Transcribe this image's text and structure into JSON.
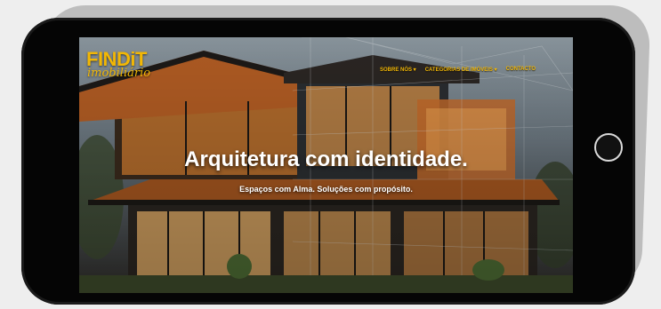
{
  "logo": {
    "brand": "FINDiT",
    "sub": "imobiliário"
  },
  "nav": {
    "items": [
      {
        "label": "SOBRE NÓS ▾"
      },
      {
        "label": "CATEGORIAS DE IMÓVEIS ▾"
      },
      {
        "label": "CONTACTO"
      }
    ]
  },
  "hero": {
    "title": "Arquitetura com identidade.",
    "subtitle": "Espaços com Alma. Soluções com propósito."
  },
  "colors": {
    "accent": "#f2b705",
    "device_frame": "#050505",
    "background": "#eeeeee"
  },
  "icons": [
    "home-button-icon"
  ]
}
